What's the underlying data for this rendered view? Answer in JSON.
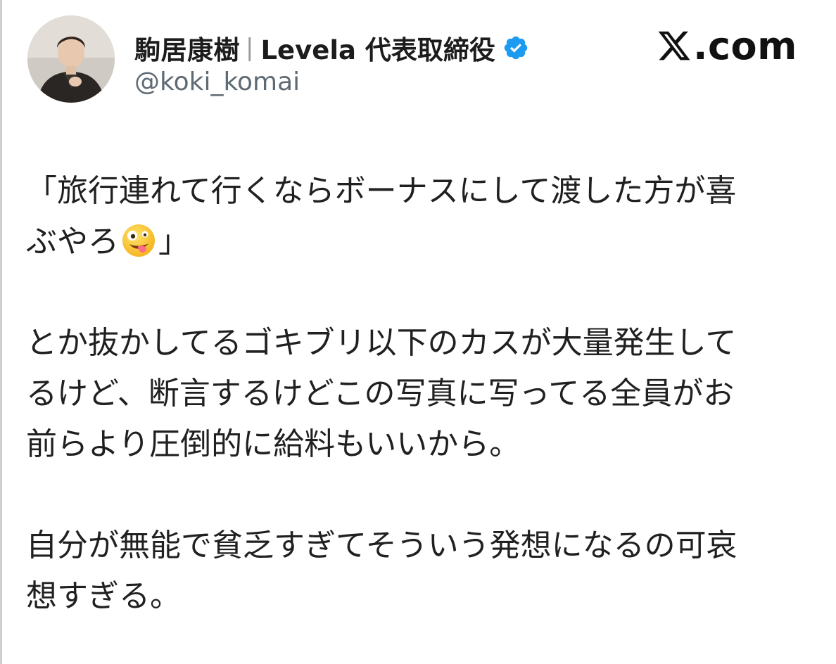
{
  "post": {
    "display_name": "駒居康樹",
    "name_separator": "|",
    "name_rest": "Levela 代表取締役",
    "handle": "@koki_komai",
    "verified": true,
    "source_brand": ".com"
  },
  "body": {
    "para1_line1": "「旅行連れて行くならボーナスにして渡した方が喜",
    "para1_line2_pre": "ぶやろ",
    "para1_emoji": "zany-face-emoji",
    "para1_line2_post": "」",
    "para2_line1": "とか抜かしてるゴキブリ以下のカスが大量発生して",
    "para2_line2": "るけど、断言するけどこの写真に写ってる全員がお",
    "para2_line3": "前らより圧倒的に給料もいいから。",
    "para3_line1": "自分が無能で貧乏すぎてそういう発想になるの可哀",
    "para3_line2": "想すぎる。"
  },
  "colors": {
    "verified_badge": "#1d9bf0",
    "handle": "#5e6a74",
    "text": "#202020"
  },
  "icons": {
    "verified": "verified-badge-icon",
    "brand": "x-logo-icon"
  }
}
